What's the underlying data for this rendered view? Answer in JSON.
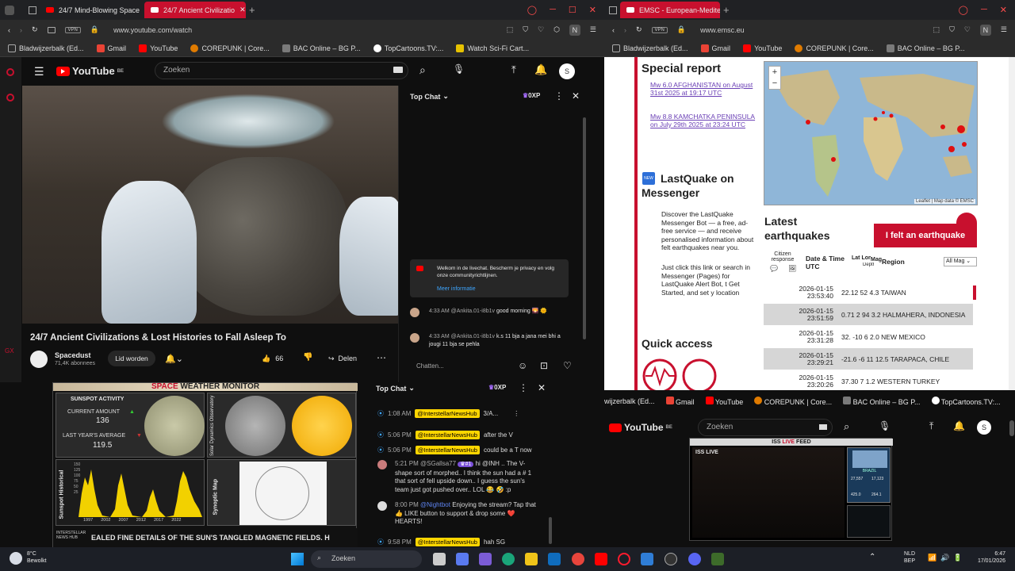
{
  "left_browser": {
    "tabs": [
      {
        "label": "24/7 Mind-Blowing Space"
      },
      {
        "label": "24/7 Ancient Civilizatio"
      }
    ],
    "url": "www.youtube.com/watch",
    "vpn": "VPN",
    "bookmarks": [
      "Bladwijzerbalk (Ed...",
      "Gmail",
      "YouTube",
      "COREPUNK | Core...",
      "BAC Online – BG P...",
      "TopCartoons.TV:...",
      "Watch Sci-Fi Cart..."
    ],
    "yt_search_placeholder": "Zoeken",
    "yt_logo": "YouTube",
    "yt_region": "BE",
    "avatar_letter": "S",
    "video_title": "24/7 Ancient Civilizations & Lost Histories to Fall Asleep To",
    "channel": "Spacedust",
    "subscribers": "71,4K abonnees",
    "join_label": "Lid worden",
    "likes": "66",
    "share_label": "Delen",
    "chat": {
      "header": "Top Chat",
      "xp": "0XP",
      "welcome": "Welkom in de livechat. Bescherm je privacy en volg onze communityrichtlijnen.",
      "more_info": "Meer informatie",
      "messages": [
        {
          "time": "4:33 AM",
          "user": "@Ankita.01-i8b1v",
          "text": "good morning 🌄 🌞"
        },
        {
          "time": "4:33 AM",
          "user": "@Ankita.01-i8b1v",
          "text": "k.s 11 bja a jana mei bhi a jougi 11 bja se pehla"
        }
      ],
      "input_placeholder": "Chatten..."
    }
  },
  "right_browser": {
    "tab_label": "EMSC - European-Mediter",
    "url": "www.emsc.eu",
    "vpn": "VPN",
    "bookmarks": [
      "Bladwijzerbalk (Ed...",
      "Gmail",
      "YouTube",
      "COREPUNK | Core...",
      "BAC Online – BG P..."
    ],
    "special_report_title": "Special report",
    "reports": [
      "Mw 6.0 AFGHANISTAN on August 31st 2025 at 19:17 UTC",
      "Mw 8.8 KAMCHATKA PENINSULA on July 29th 2025 at 23:24 UTC"
    ],
    "new_badge": "NEW",
    "lastquake_title": "LastQuake on Messenger",
    "lastquake_bullets": [
      "Discover the LastQuake Messenger Bot — a free, ad-free service — and receive personalised information about felt earthquakes near you.",
      "Just click this link or search in Messenger (Pages) for LastQuake Alert Bot, t Get Started, and set y location"
    ],
    "quick_access": "Quick access",
    "map_attribution": "Leaflet | Map data © EMSC",
    "latest_title": "Latest earthquakes",
    "felt_button": "I felt an earthquake",
    "table_headers": [
      "Citizen response",
      "Date & Time UTC",
      "Lat Lon",
      "Depth km",
      "Mag",
      "Region"
    ],
    "mag_filter": "All Mag",
    "quakes": [
      {
        "date": "2026-01-15",
        "time": "23:53:40",
        "lat": "22.12",
        "lon": "52",
        "depth": "4.3",
        "region": "TAIWAN"
      },
      {
        "date": "2026-01-15",
        "time": "23:51:59",
        "lat": "0.71",
        "lon": "2 94",
        "depth": "3.2",
        "region": "HALMAHERA, INDONESIA"
      },
      {
        "date": "2026-01-15",
        "time": "23:31:28",
        "lat": "32.",
        "lon": "-10",
        "depth": "6",
        "region": "2.0 NEW MEXICO"
      },
      {
        "date": "2026-01-15",
        "time": "23:29:21",
        "lat": "-21.6",
        "lon": "-6 11",
        "depth": "12.5",
        "region": "TARAPACA, CHILE"
      },
      {
        "date": "2026-01-15",
        "time": "23:20:26",
        "lat": "37.30",
        "lon": "7",
        "depth": "1.2",
        "region": "WESTERN TURKEY"
      }
    ]
  },
  "sun_monitor": {
    "title_a": "SPACE",
    "title_b": "WEATHER MONITOR",
    "activity_title": "SUNSPOT ACTIVITY",
    "current_label": "CURRENT AMOUNT",
    "current_value": "136",
    "last_label": "LAST YEAR'S AVERAGE",
    "last_value": "119.5",
    "sdo_label": "Solar Dynamics Observatory",
    "hist_label": "Sunspot Historical",
    "synoptic_label": "Synoptic Map",
    "hist_years": [
      "1997",
      "2002",
      "2007",
      "2012",
      "2017",
      "2022"
    ],
    "hist_ticks": [
      "150",
      "125",
      "100",
      "75",
      "50",
      "25"
    ],
    "ticker": "EALED FINE DETAILS OF THE SUN'S TANGLED MAGNETIC FIELDS.  H",
    "logo": "INTERSTELLAR NEWS HUB"
  },
  "chat2": {
    "header": "Top Chat",
    "xp": "0XP",
    "messages": [
      {
        "time": "1:08 AM",
        "user": "@InterstellarNewsHub",
        "text": "3/A..."
      },
      {
        "time": "5:06 PM",
        "user": "@InterstellarNewsHub",
        "text": "after the V"
      },
      {
        "time": "5:06 PM",
        "user": "@InterstellarNewsHub",
        "text": "could be a T now"
      },
      {
        "time": "5:21 PM",
        "user": "@SGallsa77",
        "badge": "#1",
        "text": "hi @INH .. The V-shape sort of morphed.. I think the sun had a # 1 that sort of fell upside down.. I guess the sun's team just got pushed over.. LOL 😂 🤣 :p"
      },
      {
        "time": "8:00 PM",
        "user": "@Nightbot",
        "text": "Enjoying the stream? Tap that 👍 LIKE button to support & drop some ❤️ HEARTS!"
      },
      {
        "time": "9:58 PM",
        "user": "@InterstellarNewsHub",
        "text": "hah SG"
      }
    ]
  },
  "iss": {
    "bookmarks": [
      "wijzerbalk (Ed...",
      "Gmail",
      "YouTube",
      "COREPUNK | Core...",
      "BAC Online – BG P...",
      "TopCartoons.TV:..."
    ],
    "search_placeholder": "Zoeken",
    "logo": "YouTube",
    "region": "BE",
    "avatar": "S",
    "feed_title_a": "ISS",
    "feed_title_b": "LIVE",
    "feed_title_c": "FEED",
    "live_label": "ISS LIVE",
    "country": "BRAZIL",
    "stats": [
      "27,557",
      "17,123",
      "425.0",
      "264.1"
    ]
  },
  "taskbar": {
    "weather_temp": "8°C",
    "weather_desc": "Bewolkt",
    "search": "Zoeken",
    "lang": "NLD",
    "lang2": "BEP",
    "time": "6:47",
    "date": "17/01/2026"
  },
  "colors": {
    "accent": "#c8102e",
    "yt_red": "#ff0000",
    "badge_yellow": "#ffd600",
    "link": "#6a3fb5"
  }
}
